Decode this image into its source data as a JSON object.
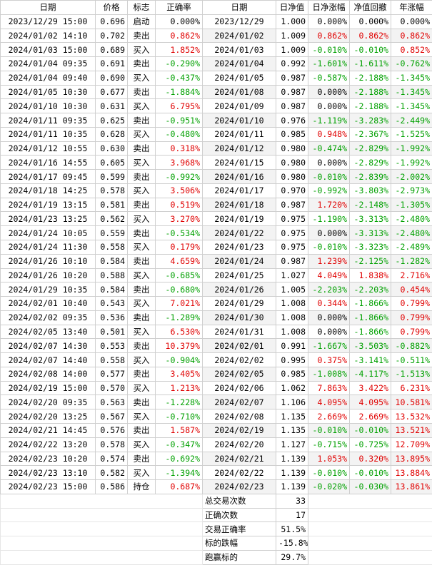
{
  "headers": [
    "日期",
    "价格",
    "标志",
    "正确率",
    "日期",
    "日净值",
    "日净涨幅",
    "净值回撤",
    "年涨幅"
  ],
  "rows": [
    {
      "dt": "2023/12/29  15:00",
      "price": "0.696",
      "tag": "启动",
      "acc": "0.000%",
      "acc_c": "blk",
      "d": "2023/12/29",
      "nav": "1.000",
      "chg": "0.000%",
      "chg_c": "blk",
      "dd": "0.000%",
      "dd_c": "blk",
      "yr": "0.000%",
      "yr_c": "blk"
    },
    {
      "dt": "2024/01/02  14:10",
      "price": "0.702",
      "tag": "卖出",
      "acc": "0.862%",
      "acc_c": "red",
      "d": "2024/01/02",
      "nav": "1.009",
      "chg": "0.862%",
      "chg_c": "red",
      "dd": "0.862%",
      "dd_c": "red",
      "yr": "0.862%",
      "yr_c": "red"
    },
    {
      "dt": "2024/01/03  15:00",
      "price": "0.689",
      "tag": "买入",
      "acc": "1.852%",
      "acc_c": "red",
      "d": "2024/01/03",
      "nav": "1.009",
      "chg": "-0.010%",
      "chg_c": "green",
      "dd": "-0.010%",
      "dd_c": "green",
      "yr": "0.852%",
      "yr_c": "red"
    },
    {
      "dt": "2024/01/04  09:35",
      "price": "0.691",
      "tag": "卖出",
      "acc": "-0.290%",
      "acc_c": "green",
      "d": "2024/01/04",
      "nav": "0.992",
      "chg": "-1.601%",
      "chg_c": "green",
      "dd": "-1.611%",
      "dd_c": "green",
      "yr": "-0.762%",
      "yr_c": "green"
    },
    {
      "dt": "2024/01/04  09:40",
      "price": "0.690",
      "tag": "买入",
      "acc": "-0.437%",
      "acc_c": "green",
      "d": "2024/01/05",
      "nav": "0.987",
      "chg": "-0.587%",
      "chg_c": "green",
      "dd": "-2.188%",
      "dd_c": "green",
      "yr": "-1.345%",
      "yr_c": "green"
    },
    {
      "dt": "2024/01/05  10:30",
      "price": "0.677",
      "tag": "卖出",
      "acc": "-1.884%",
      "acc_c": "green",
      "d": "2024/01/08",
      "nav": "0.987",
      "chg": "0.000%",
      "chg_c": "blk",
      "dd": "-2.188%",
      "dd_c": "green",
      "yr": "-1.345%",
      "yr_c": "green"
    },
    {
      "dt": "2024/01/10  10:30",
      "price": "0.631",
      "tag": "买入",
      "acc": "6.795%",
      "acc_c": "red",
      "d": "2024/01/09",
      "nav": "0.987",
      "chg": "0.000%",
      "chg_c": "blk",
      "dd": "-2.188%",
      "dd_c": "green",
      "yr": "-1.345%",
      "yr_c": "green"
    },
    {
      "dt": "2024/01/11  09:35",
      "price": "0.625",
      "tag": "卖出",
      "acc": "-0.951%",
      "acc_c": "green",
      "d": "2024/01/10",
      "nav": "0.976",
      "chg": "-1.119%",
      "chg_c": "green",
      "dd": "-3.283%",
      "dd_c": "green",
      "yr": "-2.449%",
      "yr_c": "green"
    },
    {
      "dt": "2024/01/11  10:35",
      "price": "0.628",
      "tag": "买入",
      "acc": "-0.480%",
      "acc_c": "green",
      "d": "2024/01/11",
      "nav": "0.985",
      "chg": "0.948%",
      "chg_c": "red",
      "dd": "-2.367%",
      "dd_c": "green",
      "yr": "-1.525%",
      "yr_c": "green"
    },
    {
      "dt": "2024/01/12  10:55",
      "price": "0.630",
      "tag": "卖出",
      "acc": "0.318%",
      "acc_c": "red",
      "d": "2024/01/12",
      "nav": "0.980",
      "chg": "-0.474%",
      "chg_c": "green",
      "dd": "-2.829%",
      "dd_c": "green",
      "yr": "-1.992%",
      "yr_c": "green"
    },
    {
      "dt": "2024/01/16  14:55",
      "price": "0.605",
      "tag": "买入",
      "acc": "3.968%",
      "acc_c": "red",
      "d": "2024/01/15",
      "nav": "0.980",
      "chg": "0.000%",
      "chg_c": "blk",
      "dd": "-2.829%",
      "dd_c": "green",
      "yr": "-1.992%",
      "yr_c": "green"
    },
    {
      "dt": "2024/01/17  09:45",
      "price": "0.599",
      "tag": "卖出",
      "acc": "-0.992%",
      "acc_c": "green",
      "d": "2024/01/16",
      "nav": "0.980",
      "chg": "-0.010%",
      "chg_c": "green",
      "dd": "-2.839%",
      "dd_c": "green",
      "yr": "-2.002%",
      "yr_c": "green"
    },
    {
      "dt": "2024/01/18  14:25",
      "price": "0.578",
      "tag": "买入",
      "acc": "3.506%",
      "acc_c": "red",
      "d": "2024/01/17",
      "nav": "0.970",
      "chg": "-0.992%",
      "chg_c": "green",
      "dd": "-3.803%",
      "dd_c": "green",
      "yr": "-2.973%",
      "yr_c": "green"
    },
    {
      "dt": "2024/01/19  13:15",
      "price": "0.581",
      "tag": "卖出",
      "acc": "0.519%",
      "acc_c": "red",
      "d": "2024/01/18",
      "nav": "0.987",
      "chg": "1.720%",
      "chg_c": "red",
      "dd": "-2.148%",
      "dd_c": "green",
      "yr": "-1.305%",
      "yr_c": "green"
    },
    {
      "dt": "2024/01/23  13:25",
      "price": "0.562",
      "tag": "买入",
      "acc": "3.270%",
      "acc_c": "red",
      "d": "2024/01/19",
      "nav": "0.975",
      "chg": "-1.190%",
      "chg_c": "green",
      "dd": "-3.313%",
      "dd_c": "green",
      "yr": "-2.480%",
      "yr_c": "green"
    },
    {
      "dt": "2024/01/24  10:05",
      "price": "0.559",
      "tag": "卖出",
      "acc": "-0.534%",
      "acc_c": "green",
      "d": "2024/01/22",
      "nav": "0.975",
      "chg": "0.000%",
      "chg_c": "blk",
      "dd": "-3.313%",
      "dd_c": "green",
      "yr": "-2.480%",
      "yr_c": "green"
    },
    {
      "dt": "2024/01/24  11:30",
      "price": "0.558",
      "tag": "买入",
      "acc": "0.179%",
      "acc_c": "red",
      "d": "2024/01/23",
      "nav": "0.975",
      "chg": "-0.010%",
      "chg_c": "green",
      "dd": "-3.323%",
      "dd_c": "green",
      "yr": "-2.489%",
      "yr_c": "green"
    },
    {
      "dt": "2024/01/26  10:10",
      "price": "0.584",
      "tag": "卖出",
      "acc": "4.659%",
      "acc_c": "red",
      "d": "2024/01/24",
      "nav": "0.987",
      "chg": "1.239%",
      "chg_c": "red",
      "dd": "-2.125%",
      "dd_c": "green",
      "yr": "-1.282%",
      "yr_c": "green"
    },
    {
      "dt": "2024/01/26  10:20",
      "price": "0.588",
      "tag": "买入",
      "acc": "-0.685%",
      "acc_c": "green",
      "d": "2024/01/25",
      "nav": "1.027",
      "chg": "4.049%",
      "chg_c": "red",
      "dd": "1.838%",
      "dd_c": "red",
      "yr": "2.716%",
      "yr_c": "red"
    },
    {
      "dt": "2024/01/29  10:35",
      "price": "0.584",
      "tag": "卖出",
      "acc": "-0.680%",
      "acc_c": "green",
      "d": "2024/01/26",
      "nav": "1.005",
      "chg": "-2.203%",
      "chg_c": "green",
      "dd": "-2.203%",
      "dd_c": "green",
      "yr": "0.454%",
      "yr_c": "red"
    },
    {
      "dt": "2024/02/01  10:40",
      "price": "0.543",
      "tag": "买入",
      "acc": "7.021%",
      "acc_c": "red",
      "d": "2024/01/29",
      "nav": "1.008",
      "chg": "0.344%",
      "chg_c": "red",
      "dd": "-1.866%",
      "dd_c": "green",
      "yr": "0.799%",
      "yr_c": "red"
    },
    {
      "dt": "2024/02/02  09:35",
      "price": "0.536",
      "tag": "卖出",
      "acc": "-1.289%",
      "acc_c": "green",
      "d": "2024/01/30",
      "nav": "1.008",
      "chg": "0.000%",
      "chg_c": "blk",
      "dd": "-1.866%",
      "dd_c": "green",
      "yr": "0.799%",
      "yr_c": "red"
    },
    {
      "dt": "2024/02/05  13:40",
      "price": "0.501",
      "tag": "买入",
      "acc": "6.530%",
      "acc_c": "red",
      "d": "2024/01/31",
      "nav": "1.008",
      "chg": "0.000%",
      "chg_c": "blk",
      "dd": "-1.866%",
      "dd_c": "green",
      "yr": "0.799%",
      "yr_c": "red"
    },
    {
      "dt": "2024/02/07  14:30",
      "price": "0.553",
      "tag": "卖出",
      "acc": "10.379%",
      "acc_c": "red",
      "d": "2024/02/01",
      "nav": "0.991",
      "chg": "-1.667%",
      "chg_c": "green",
      "dd": "-3.503%",
      "dd_c": "green",
      "yr": "-0.882%",
      "yr_c": "green"
    },
    {
      "dt": "2024/02/07  14:40",
      "price": "0.558",
      "tag": "买入",
      "acc": "-0.904%",
      "acc_c": "green",
      "d": "2024/02/02",
      "nav": "0.995",
      "chg": "0.375%",
      "chg_c": "red",
      "dd": "-3.141%",
      "dd_c": "green",
      "yr": "-0.511%",
      "yr_c": "green"
    },
    {
      "dt": "2024/02/08  14:00",
      "price": "0.577",
      "tag": "卖出",
      "acc": "3.405%",
      "acc_c": "red",
      "d": "2024/02/05",
      "nav": "0.985",
      "chg": "-1.008%",
      "chg_c": "green",
      "dd": "-4.117%",
      "dd_c": "green",
      "yr": "-1.513%",
      "yr_c": "green"
    },
    {
      "dt": "2024/02/19  15:00",
      "price": "0.570",
      "tag": "买入",
      "acc": "1.213%",
      "acc_c": "red",
      "d": "2024/02/06",
      "nav": "1.062",
      "chg": "7.863%",
      "chg_c": "red",
      "dd": "3.422%",
      "dd_c": "red",
      "yr": "6.231%",
      "yr_c": "red"
    },
    {
      "dt": "2024/02/20  09:35",
      "price": "0.563",
      "tag": "卖出",
      "acc": "-1.228%",
      "acc_c": "green",
      "d": "2024/02/07",
      "nav": "1.106",
      "chg": "4.095%",
      "chg_c": "red",
      "dd": "4.095%",
      "dd_c": "red",
      "yr": "10.581%",
      "yr_c": "red"
    },
    {
      "dt": "2024/02/20  13:25",
      "price": "0.567",
      "tag": "买入",
      "acc": "-0.710%",
      "acc_c": "green",
      "d": "2024/02/08",
      "nav": "1.135",
      "chg": "2.669%",
      "chg_c": "red",
      "dd": "2.669%",
      "dd_c": "red",
      "yr": "13.532%",
      "yr_c": "red"
    },
    {
      "dt": "2024/02/21  14:45",
      "price": "0.576",
      "tag": "卖出",
      "acc": "1.587%",
      "acc_c": "red",
      "d": "2024/02/19",
      "nav": "1.135",
      "chg": "-0.010%",
      "chg_c": "green",
      "dd": "-0.010%",
      "dd_c": "green",
      "yr": "13.521%",
      "yr_c": "red"
    },
    {
      "dt": "2024/02/22  13:20",
      "price": "0.578",
      "tag": "买入",
      "acc": "-0.347%",
      "acc_c": "green",
      "d": "2024/02/20",
      "nav": "1.127",
      "chg": "-0.715%",
      "chg_c": "green",
      "dd": "-0.725%",
      "dd_c": "green",
      "yr": "12.709%",
      "yr_c": "red"
    },
    {
      "dt": "2024/02/23  10:20",
      "price": "0.574",
      "tag": "卖出",
      "acc": "-0.692%",
      "acc_c": "green",
      "d": "2024/02/21",
      "nav": "1.139",
      "chg": "1.053%",
      "chg_c": "red",
      "dd": "0.320%",
      "dd_c": "red",
      "yr": "13.895%",
      "yr_c": "red"
    },
    {
      "dt": "2024/02/23  13:10",
      "price": "0.582",
      "tag": "买入",
      "acc": "-1.394%",
      "acc_c": "green",
      "d": "2024/02/22",
      "nav": "1.139",
      "chg": "-0.010%",
      "chg_c": "green",
      "dd": "-0.010%",
      "dd_c": "green",
      "yr": "13.884%",
      "yr_c": "red"
    },
    {
      "dt": "2024/02/23  15:00",
      "price": "0.586",
      "tag": "持仓",
      "acc": "0.687%",
      "acc_c": "red",
      "d": "2024/02/23",
      "nav": "1.139",
      "chg": "-0.020%",
      "chg_c": "green",
      "dd": "-0.030%",
      "dd_c": "green",
      "yr": "13.861%",
      "yr_c": "red"
    }
  ],
  "summary": [
    {
      "label": "总交易次数",
      "value": "33"
    },
    {
      "label": "正确次数",
      "value": "17"
    },
    {
      "label": "交易正确率",
      "value": "51.5%"
    },
    {
      "label": "标的跌幅",
      "value": "-15.8%"
    },
    {
      "label": "跑赢标的",
      "value": "29.7%"
    }
  ],
  "colors": {
    "positive": "#e00000",
    "negative": "#00a000",
    "neutral": "#000000",
    "grid": "#cfcfcf"
  }
}
